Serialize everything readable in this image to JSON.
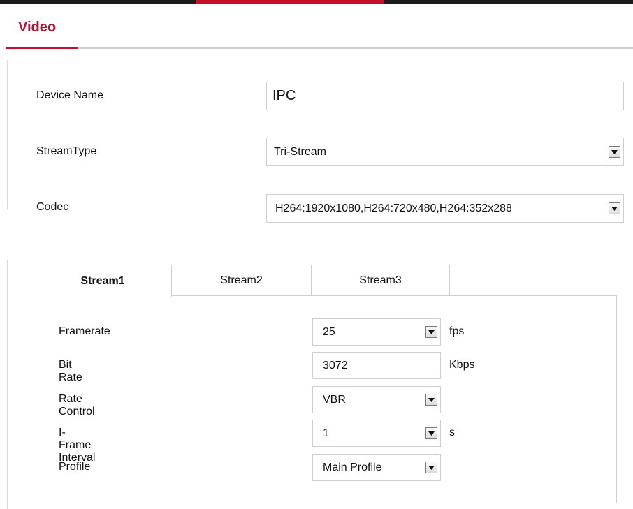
{
  "page": {
    "title": "Video"
  },
  "fields": {
    "device_name": {
      "label": "Device Name",
      "value": "IPC"
    },
    "stream_type": {
      "label": "StreamType",
      "value": "Tri-Stream"
    },
    "codec": {
      "label": "Codec",
      "value": "H264:1920x1080,H264:720x480,H264:352x288"
    }
  },
  "tabs": [
    {
      "label": "Stream1",
      "active": true
    },
    {
      "label": "Stream2",
      "active": false
    },
    {
      "label": "Stream3",
      "active": false
    }
  ],
  "stream": {
    "framerate": {
      "label": "Framerate",
      "value": "25",
      "unit": "fps"
    },
    "bitrate": {
      "label": "Bit Rate",
      "value": "3072",
      "unit": "Kbps"
    },
    "rate_control": {
      "label": "Rate Control",
      "value": "VBR"
    },
    "iframe_interval": {
      "label": "I-Frame Interval",
      "value": "1",
      "unit": "s"
    },
    "profile": {
      "label": "Profile",
      "value": "Main Profile"
    }
  },
  "colors": {
    "accent": "#c8102e",
    "heading": "#b51230",
    "border": "#cfcfcf"
  },
  "icons": {
    "dropdown": "chevron-down-icon"
  }
}
